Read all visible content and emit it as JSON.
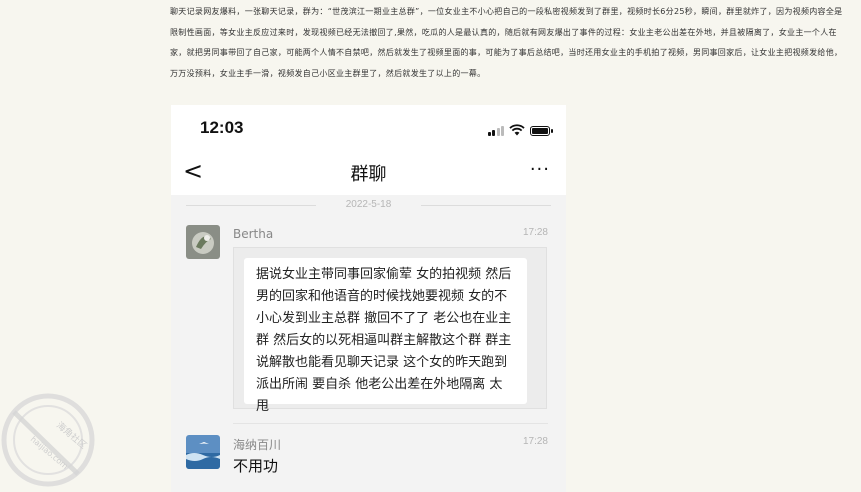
{
  "article": {
    "text": "聊天记录网友爆料，一张聊天记录，群为：“世茂滨江一期业主总群”，一位女业主不小心把自己的一段私密视频发到了群里，视频时长6分25秒，瞬间，群里就炸了，因为视频内容全是限制性画面，等女业主反应过来时，发现视频已经无法撤回了,果然，吃瓜的人是最认真的，随后就有网友爆出了事件的过程：女业主老公出差在外地，并且被隔离了，女业主一个人在家，就把男同事带回了自己家，可能两个人情不自禁吧，然后就发生了视频里面的事，可能为了事后总结吧，当时还用女业主的手机拍了视频，男同事回家后，让女业主把视频发给他，万万没预料，女业主手一滑，视频发自己小区业主群里了，然后就发生了以上的一幕。"
  },
  "phone": {
    "status_time": "12:03",
    "icons": [
      "signal-icon",
      "wifi-icon",
      "battery-icon"
    ],
    "nav": {
      "back_label": "<",
      "title": "群聊",
      "more_label": "···"
    },
    "date_separator": "2022-5-18",
    "messages": [
      {
        "sender": "Bertha",
        "time": "17:28",
        "quote": "据说女业主带同事回家偷荤 女的拍视频 然后男的回家和他语音的时候找她要视频 女的不小心发到业主总群 撤回不了了 老公也在业主群 然后女的以死相逼叫群主解散这个群 群主说解散也能看见聊天记录 这个女的昨天跑到派出所闹 要自杀 他老公出差在外地隔离 太甩"
      },
      {
        "sender": "海纳百川",
        "time": "17:28",
        "text": "不用功"
      }
    ]
  },
  "watermark": {
    "text": "海角社区",
    "url": "haijiao.com"
  }
}
